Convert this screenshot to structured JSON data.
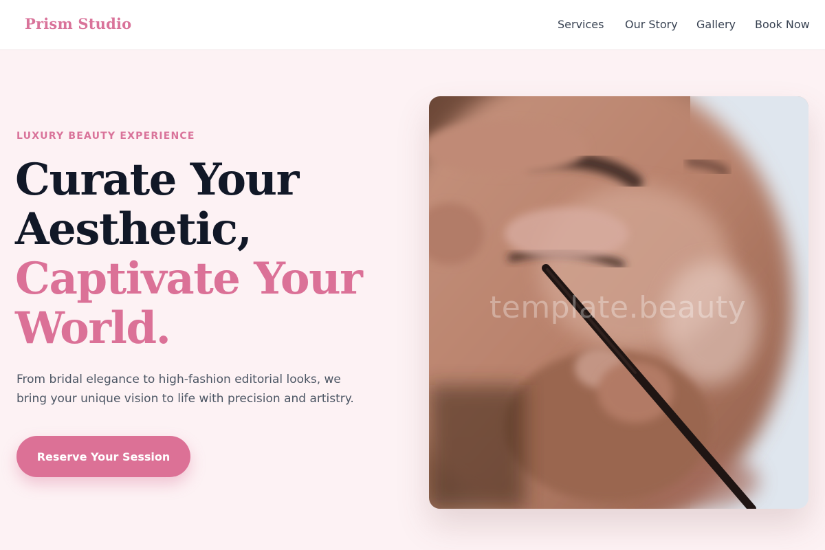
{
  "header": {
    "brand": "Prism Studio",
    "nav": [
      "Services",
      "Our Story",
      "Gallery",
      "Book Now"
    ]
  },
  "hero": {
    "eyebrow": "LUXURY BEAUTY EXPERIENCE",
    "headline_dark": [
      "Curate Your",
      "Aesthetic,"
    ],
    "headline_accent": [
      "Captivate Your",
      "World."
    ],
    "lead": "From bridal elegance to high-fashion editorial looks, we bring your unique vision to life with precision and artistry.",
    "cta_label": "Reserve Your Session",
    "image_watermark": "template.beauty"
  },
  "colors": {
    "accent": "#dc7196",
    "background": "#fdf2f4",
    "heading": "#111827"
  }
}
